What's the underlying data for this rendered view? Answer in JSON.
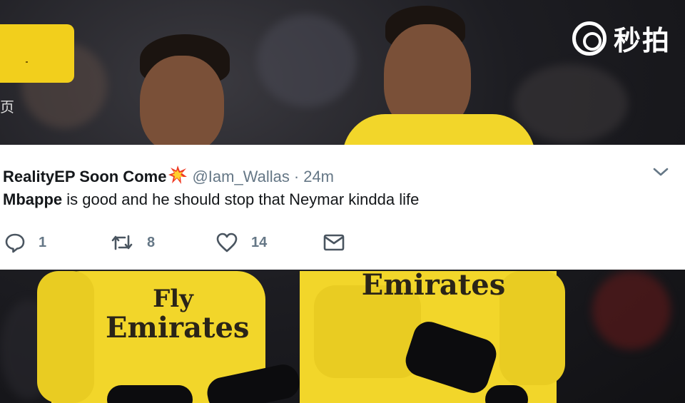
{
  "watermark": {
    "label": "秒拍",
    "icon": "miaopai-logo-icon"
  },
  "overlay": {
    "side_char": "页"
  },
  "kits": {
    "left_sponsor_line1": "Fly",
    "left_sponsor_line2": "Emirates",
    "right_sponsor": "Emirates"
  },
  "tweet": {
    "display_name": "RealityEP Soon Come",
    "name_emoji": "collision-icon",
    "handle": "@Iam_Wallas",
    "separator": "·",
    "time": "24m",
    "text_bold": "Mbappe",
    "text_rest": " is good and he should stop that Neymar kindda life",
    "actions": {
      "reply_count": "1",
      "retweet_count": "8",
      "like_count": "14"
    }
  },
  "colors": {
    "kit_yellow": "#f2d62a",
    "twitter_gray": "#657786",
    "card_bg": "#ffffff"
  }
}
